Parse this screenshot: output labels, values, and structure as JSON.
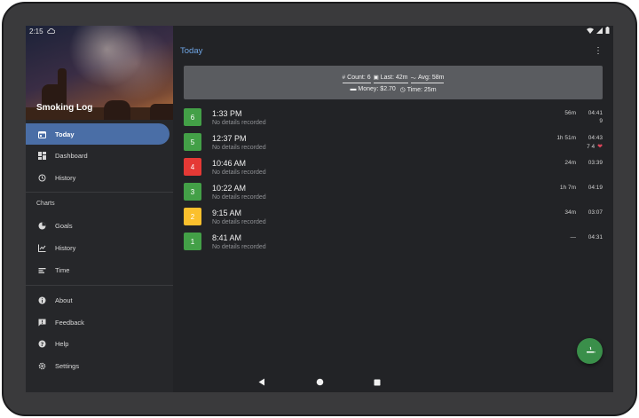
{
  "status_bar": {
    "time": "2:15"
  },
  "drawer": {
    "app_title": "Smoking Log",
    "items": [
      {
        "label": "Today",
        "icon": "calendar-icon"
      },
      {
        "label": "Dashboard",
        "icon": "dashboard-icon"
      },
      {
        "label": "History",
        "icon": "history-icon"
      }
    ],
    "charts_section_label": "Charts",
    "chart_items": [
      {
        "label": "Goals",
        "icon": "pie-chart-icon"
      },
      {
        "label": "History",
        "icon": "line-chart-icon"
      },
      {
        "label": "Time",
        "icon": "bar-chart-icon"
      }
    ],
    "bottom_items": [
      {
        "label": "About",
        "icon": "info-icon"
      },
      {
        "label": "Feedback",
        "icon": "feedback-icon"
      },
      {
        "label": "Help",
        "icon": "help-icon"
      },
      {
        "label": "Settings",
        "icon": "gear-icon"
      }
    ]
  },
  "header": {
    "title": "Today"
  },
  "summary": {
    "count": "Count: 6",
    "last": "Last: 42m",
    "avg": "Avg: 58m",
    "money": "Money: $2.70",
    "time": "Time: 25m"
  },
  "entries": [
    {
      "number": "6",
      "time": "1:33 PM",
      "detail": "No details recorded",
      "gap": "56m",
      "duration": "04:41",
      "extra": "9",
      "color": "#43a047"
    },
    {
      "number": "5",
      "time": "12:37 PM",
      "detail": "No details recorded",
      "gap": "1h 51m",
      "duration": "04:43",
      "extra": "7  4",
      "color": "#43a047"
    },
    {
      "number": "4",
      "time": "10:46 AM",
      "detail": "No details recorded",
      "gap": "24m",
      "duration": "03:39",
      "extra": "",
      "color": "#e53935"
    },
    {
      "number": "3",
      "time": "10:22 AM",
      "detail": "No details recorded",
      "gap": "1h 7m",
      "duration": "04:19",
      "extra": "",
      "color": "#43a047"
    },
    {
      "number": "2",
      "time": "9:15 AM",
      "detail": "No details recorded",
      "gap": "34m",
      "duration": "03:07",
      "extra": "",
      "color": "#fbc02d"
    },
    {
      "number": "1",
      "time": "8:41 AM",
      "detail": "No details recorded",
      "gap": "—",
      "duration": "04:31",
      "extra": "",
      "color": "#43a047"
    }
  ],
  "colors": {
    "accent": "#6fa6e6",
    "active_nav": "#4a6ea6",
    "fab": "#3a8f4a"
  }
}
